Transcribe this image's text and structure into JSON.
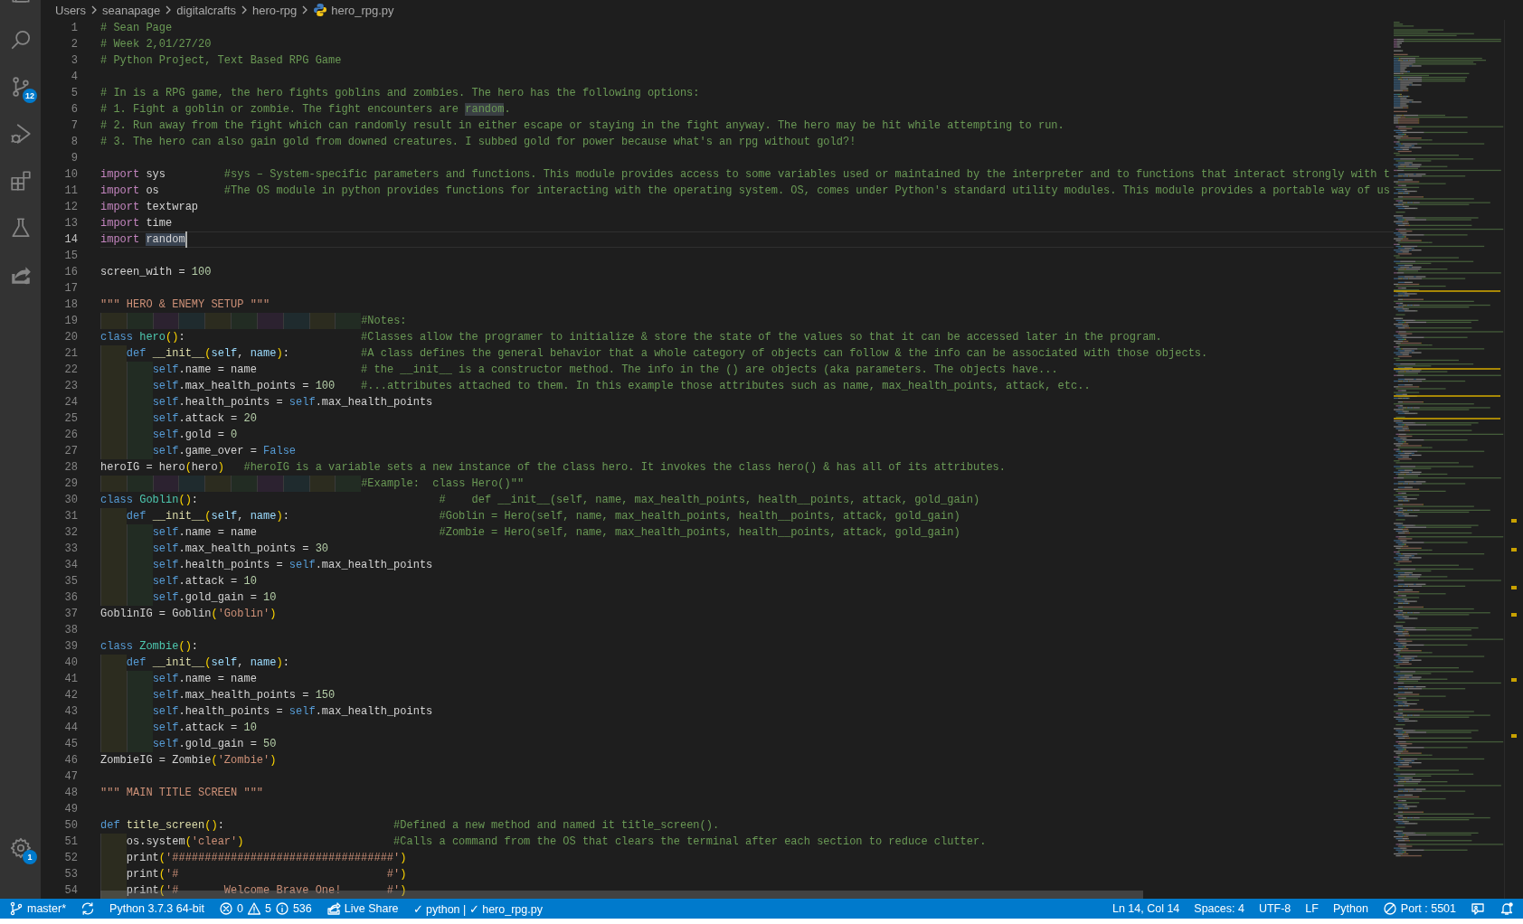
{
  "activity_bar": {
    "items": [
      {
        "kind": "files"
      },
      {
        "kind": "search"
      },
      {
        "kind": "source_control",
        "badge": "12"
      },
      {
        "kind": "run"
      },
      {
        "kind": "extensions"
      },
      {
        "kind": "testing"
      },
      {
        "kind": "share"
      }
    ],
    "bottom": [
      {
        "kind": "settings",
        "badge": "1"
      }
    ]
  },
  "breadcrumb": [
    {
      "label": "Users"
    },
    {
      "label": "seanapage"
    },
    {
      "label": "digitalcrafts"
    },
    {
      "label": "hero-rpg"
    },
    {
      "label": "hero_rpg.py",
      "kind": "python_file"
    }
  ],
  "editor": {
    "lines": [
      {
        "number": "1",
        "current": false,
        "tokens": [
          {
            "kind": "comment",
            "text": "# Sean Page"
          }
        ]
      },
      {
        "number": "2",
        "current": false,
        "tokens": [
          {
            "kind": "comment",
            "text": "# Week 2,01/27/20"
          }
        ]
      },
      {
        "number": "3",
        "current": false,
        "tokens": [
          {
            "kind": "comment",
            "text": "# Python Project, Text Based RPG Game"
          }
        ]
      },
      {
        "number": "4",
        "current": false
      },
      {
        "number": "5",
        "current": false,
        "tokens": [
          {
            "kind": "comment",
            "text": "# In is a RPG game, the hero fights goblins and zombies. The hero has the following options:"
          }
        ]
      },
      {
        "number": "6",
        "current": false,
        "tokens": [
          {
            "kind": "comment",
            "text": "# 1. Fight a goblin or zombie. The fight encounters are "
          },
          {
            "kind": "match",
            "text": "random"
          },
          {
            "kind": "comment",
            "text": "."
          }
        ]
      },
      {
        "number": "7",
        "current": false,
        "tokens": [
          {
            "kind": "comment",
            "text": "# 2. Run away from the fight which can randomly result in either escape or staying in the fight anyway. The hero may be hit while attempting to run."
          }
        ]
      },
      {
        "number": "8",
        "current": false,
        "tokens": [
          {
            "kind": "comment",
            "text": "# 3. The hero can also gain gold from downed creatures. I subbed gold for power because what's an rpg without gold?!"
          }
        ]
      },
      {
        "number": "9",
        "current": false
      },
      {
        "number": "10",
        "current": false,
        "tokens": [
          {
            "kind": "import",
            "text": "import"
          },
          {
            "kind": "plain",
            "text": " sys         "
          },
          {
            "kind": "comment",
            "text": "#sys – System-specific parameters and functions. This module provides access to some variables used or maintained by the interpreter and to functions that interact strongly with t"
          }
        ]
      },
      {
        "number": "11",
        "current": false,
        "tokens": [
          {
            "kind": "import",
            "text": "import"
          },
          {
            "kind": "plain",
            "text": " os          "
          },
          {
            "kind": "comment",
            "text": "#The OS module in python provides functions for interacting with the operating system. OS, comes under Python's standard utility modules. This module provides a portable way of us"
          }
        ]
      },
      {
        "number": "12",
        "current": false,
        "tokens": [
          {
            "kind": "import",
            "text": "import"
          },
          {
            "kind": "plain",
            "text": " textwrap"
          }
        ]
      },
      {
        "number": "13",
        "current": false,
        "tokens": [
          {
            "kind": "import",
            "text": "import"
          },
          {
            "kind": "plain",
            "text": " time"
          }
        ]
      },
      {
        "number": "14",
        "current": true,
        "tokens": [
          {
            "kind": "import",
            "text": "import "
          },
          {
            "kind": "selection",
            "text": "random"
          }
        ]
      },
      {
        "number": "15",
        "current": false
      },
      {
        "number": "16",
        "current": false,
        "tokens": [
          {
            "kind": "plain",
            "text": "screen_with = "
          },
          {
            "kind": "number",
            "text": "100"
          }
        ]
      },
      {
        "number": "17",
        "current": false
      },
      {
        "number": "18",
        "current": false,
        "tokens": [
          {
            "kind": "string",
            "text": "\"\"\" HERO & ENEMY SETUP \"\"\""
          }
        ]
      },
      {
        "number": "19",
        "current": false,
        "tokens": [
          {
            "kind": "comment",
            "text": "                                        #Notes:"
          }
        ]
      },
      {
        "number": "20",
        "current": false,
        "tokens": [
          {
            "kind": "keyword",
            "text": "class "
          },
          {
            "kind": "type",
            "text": "hero"
          },
          {
            "kind": "bracket",
            "text": "()"
          },
          {
            "kind": "plain",
            "text": ":                           "
          },
          {
            "kind": "comment",
            "text": "#Classes allow the programer to initialize & store the state of the values so that it can be accessed later in the program."
          }
        ]
      },
      {
        "number": "21",
        "current": false,
        "tokens": [
          {
            "kind": "keyword",
            "text": "    def "
          },
          {
            "kind": "function",
            "text": "__init__"
          },
          {
            "kind": "bracket",
            "text": "("
          },
          {
            "kind": "param",
            "text": "self"
          },
          {
            "kind": "plain",
            "text": ", "
          },
          {
            "kind": "param",
            "text": "name"
          },
          {
            "kind": "bracket",
            "text": ")"
          },
          {
            "kind": "plain",
            "text": ":           "
          },
          {
            "kind": "comment",
            "text": "#A class defines the general behavior that a whole category of objects can follow & the info can be associated with those objects."
          }
        ]
      },
      {
        "number": "22",
        "current": false,
        "tokens": [
          {
            "kind": "keyword",
            "text": "        self"
          },
          {
            "kind": "plain",
            "text": ".name = name                "
          },
          {
            "kind": "comment",
            "text": "# the __init__ is a constructor method. The info in the () are objects (aka parameters. The objects have..."
          }
        ]
      },
      {
        "number": "23",
        "current": false,
        "tokens": [
          {
            "kind": "keyword",
            "text": "        self"
          },
          {
            "kind": "plain",
            "text": ".max_health_points = "
          },
          {
            "kind": "number",
            "text": "100"
          },
          {
            "kind": "comment",
            "text": "    #...attributes attached to them. In this example those attributes such as name, max_health_points, attack, etc.."
          }
        ]
      },
      {
        "number": "24",
        "current": false,
        "tokens": [
          {
            "kind": "keyword",
            "text": "        self"
          },
          {
            "kind": "plain",
            "text": ".health_points = "
          },
          {
            "kind": "keyword",
            "text": "self"
          },
          {
            "kind": "plain",
            "text": ".max_health_points"
          }
        ]
      },
      {
        "number": "25",
        "current": false,
        "tokens": [
          {
            "kind": "keyword",
            "text": "        self"
          },
          {
            "kind": "plain",
            "text": ".attack = "
          },
          {
            "kind": "number",
            "text": "20"
          }
        ]
      },
      {
        "number": "26",
        "current": false,
        "tokens": [
          {
            "kind": "keyword",
            "text": "        self"
          },
          {
            "kind": "plain",
            "text": ".gold = "
          },
          {
            "kind": "number",
            "text": "0"
          }
        ]
      },
      {
        "number": "27",
        "current": false,
        "tokens": [
          {
            "kind": "keyword",
            "text": "        self"
          },
          {
            "kind": "plain",
            "text": ".game_over = "
          },
          {
            "kind": "keyword",
            "text": "False"
          }
        ]
      },
      {
        "number": "28",
        "current": false,
        "tokens": [
          {
            "kind": "plain",
            "text": "heroIG = hero"
          },
          {
            "kind": "bracket",
            "text": "("
          },
          {
            "kind": "plain",
            "text": "hero"
          },
          {
            "kind": "bracket",
            "text": ")"
          },
          {
            "kind": "comment",
            "text": "   #heroIG is a variable sets a new instance of the class hero. It invokes the class hero() & has all of its attributes."
          }
        ]
      },
      {
        "number": "29",
        "current": false,
        "tokens": [
          {
            "kind": "comment",
            "text": "                                        #Example:  class Hero()\"\""
          }
        ]
      },
      {
        "number": "30",
        "current": false,
        "tokens": [
          {
            "kind": "keyword",
            "text": "class "
          },
          {
            "kind": "type",
            "text": "Goblin"
          },
          {
            "kind": "bracket",
            "text": "()"
          },
          {
            "kind": "plain",
            "text": ":                                     "
          },
          {
            "kind": "comment",
            "text": "#    def __init__(self, name, max_health_points, health__points, attack, gold_gain)"
          }
        ]
      },
      {
        "number": "31",
        "current": false,
        "tokens": [
          {
            "kind": "keyword",
            "text": "    def "
          },
          {
            "kind": "function",
            "text": "__init__"
          },
          {
            "kind": "bracket",
            "text": "("
          },
          {
            "kind": "param",
            "text": "self"
          },
          {
            "kind": "plain",
            "text": ", "
          },
          {
            "kind": "param",
            "text": "name"
          },
          {
            "kind": "bracket",
            "text": ")"
          },
          {
            "kind": "plain",
            "text": ":                       "
          },
          {
            "kind": "comment",
            "text": "#Goblin = Hero(self, name, max_health_points, health__points, attack, gold_gain)"
          }
        ]
      },
      {
        "number": "32",
        "current": false,
        "tokens": [
          {
            "kind": "keyword",
            "text": "        self"
          },
          {
            "kind": "plain",
            "text": ".name = name                            "
          },
          {
            "kind": "comment",
            "text": "#Zombie = Hero(self, name, max_health_points, health__points, attack, gold_gain)"
          }
        ]
      },
      {
        "number": "33",
        "current": false,
        "tokens": [
          {
            "kind": "keyword",
            "text": "        self"
          },
          {
            "kind": "plain",
            "text": ".max_health_points = "
          },
          {
            "kind": "number",
            "text": "30"
          }
        ]
      },
      {
        "number": "34",
        "current": false,
        "tokens": [
          {
            "kind": "keyword",
            "text": "        self"
          },
          {
            "kind": "plain",
            "text": ".health_points = "
          },
          {
            "kind": "keyword",
            "text": "self"
          },
          {
            "kind": "plain",
            "text": ".max_health_points"
          }
        ]
      },
      {
        "number": "35",
        "current": false,
        "tokens": [
          {
            "kind": "keyword",
            "text": "        self"
          },
          {
            "kind": "plain",
            "text": ".attack = "
          },
          {
            "kind": "number",
            "text": "10"
          }
        ]
      },
      {
        "number": "36",
        "current": false,
        "tokens": [
          {
            "kind": "keyword",
            "text": "        self"
          },
          {
            "kind": "plain",
            "text": ".gold_gain = "
          },
          {
            "kind": "number",
            "text": "10"
          }
        ]
      },
      {
        "number": "37",
        "current": false,
        "tokens": [
          {
            "kind": "plain",
            "text": "GoblinIG = Goblin"
          },
          {
            "kind": "bracket",
            "text": "("
          },
          {
            "kind": "string",
            "text": "'Goblin'"
          },
          {
            "kind": "bracket",
            "text": ")"
          }
        ]
      },
      {
        "number": "38",
        "current": false
      },
      {
        "number": "39",
        "current": false,
        "tokens": [
          {
            "kind": "keyword",
            "text": "class "
          },
          {
            "kind": "type",
            "text": "Zombie"
          },
          {
            "kind": "bracket",
            "text": "()"
          },
          {
            "kind": "plain",
            "text": ":"
          }
        ]
      },
      {
        "number": "40",
        "current": false,
        "tokens": [
          {
            "kind": "keyword",
            "text": "    def "
          },
          {
            "kind": "function",
            "text": "__init__"
          },
          {
            "kind": "bracket",
            "text": "("
          },
          {
            "kind": "param",
            "text": "self"
          },
          {
            "kind": "plain",
            "text": ", "
          },
          {
            "kind": "param",
            "text": "name"
          },
          {
            "kind": "bracket",
            "text": ")"
          },
          {
            "kind": "plain",
            "text": ":"
          }
        ]
      },
      {
        "number": "41",
        "current": false,
        "tokens": [
          {
            "kind": "keyword",
            "text": "        self"
          },
          {
            "kind": "plain",
            "text": ".name = name"
          }
        ]
      },
      {
        "number": "42",
        "current": false,
        "tokens": [
          {
            "kind": "keyword",
            "text": "        self"
          },
          {
            "kind": "plain",
            "text": ".max_health_points = "
          },
          {
            "kind": "number",
            "text": "150"
          }
        ]
      },
      {
        "number": "43",
        "current": false,
        "tokens": [
          {
            "kind": "keyword",
            "text": "        self"
          },
          {
            "kind": "plain",
            "text": ".health_points = "
          },
          {
            "kind": "keyword",
            "text": "self"
          },
          {
            "kind": "plain",
            "text": ".max_health_points"
          }
        ]
      },
      {
        "number": "44",
        "current": false,
        "tokens": [
          {
            "kind": "keyword",
            "text": "        self"
          },
          {
            "kind": "plain",
            "text": ".attack = "
          },
          {
            "kind": "number",
            "text": "10"
          }
        ]
      },
      {
        "number": "45",
        "current": false,
        "tokens": [
          {
            "kind": "keyword",
            "text": "        self"
          },
          {
            "kind": "plain",
            "text": ".gold_gain = "
          },
          {
            "kind": "number",
            "text": "50"
          }
        ]
      },
      {
        "number": "46",
        "current": false,
        "tokens": [
          {
            "kind": "plain",
            "text": "ZombieIG = Zombie"
          },
          {
            "kind": "bracket",
            "text": "("
          },
          {
            "kind": "string",
            "text": "'Zombie'"
          },
          {
            "kind": "bracket",
            "text": ")"
          }
        ]
      },
      {
        "number": "47",
        "current": false
      },
      {
        "number": "48",
        "current": false,
        "tokens": [
          {
            "kind": "string",
            "text": "\"\"\" MAIN TITLE SCREEN \"\"\""
          }
        ]
      },
      {
        "number": "49",
        "current": false
      },
      {
        "number": "50",
        "current": false,
        "tokens": [
          {
            "kind": "keyword",
            "text": "def "
          },
          {
            "kind": "function",
            "text": "title_screen"
          },
          {
            "kind": "bracket",
            "text": "()"
          },
          {
            "kind": "plain",
            "text": ":                          "
          },
          {
            "kind": "comment",
            "text": "#Defined a new method and named it title_screen()."
          }
        ]
      },
      {
        "number": "51",
        "current": false,
        "tokens": [
          {
            "kind": "plain",
            "text": "    os.system"
          },
          {
            "kind": "bracket",
            "text": "("
          },
          {
            "kind": "string",
            "text": "'clear'"
          },
          {
            "kind": "bracket",
            "text": ")"
          },
          {
            "kind": "comment",
            "text": "                       #Calls a command from the OS that clears the terminal after each section to reduce clutter."
          }
        ]
      },
      {
        "number": "52",
        "current": false,
        "tokens": [
          {
            "kind": "plain",
            "text": "    print"
          },
          {
            "kind": "bracket",
            "text": "("
          },
          {
            "kind": "string",
            "text": "'##################################'"
          },
          {
            "kind": "bracket",
            "text": ")"
          }
        ]
      },
      {
        "number": "53",
        "current": false,
        "tokens": [
          {
            "kind": "plain",
            "text": "    print"
          },
          {
            "kind": "bracket",
            "text": "("
          },
          {
            "kind": "string",
            "text": "'#                                #'"
          },
          {
            "kind": "bracket",
            "text": ")"
          }
        ]
      },
      {
        "number": "54",
        "current": false,
        "tokens": [
          {
            "kind": "plain",
            "text": "    print"
          },
          {
            "kind": "bracket",
            "text": "("
          },
          {
            "kind": "string",
            "text": "'#       Welcome Brave One!       #'"
          },
          {
            "kind": "bracket",
            "text": ")"
          }
        ]
      }
    ]
  },
  "status_bar": {
    "left": [
      {
        "kind": "branch",
        "text": "master*"
      },
      {
        "kind": "sync"
      },
      {
        "kind": "plain",
        "text": "Python 3.7.3 64-bit"
      },
      {
        "kind": "problems",
        "errors": "0",
        "warnings": "5",
        "infos": "536"
      },
      {
        "kind": "live_share",
        "text": "Live Share"
      },
      {
        "kind": "plain",
        "text": "✓ python | ✓ hero_rpg.py"
      }
    ],
    "right": [
      {
        "kind": "plain",
        "text": "Ln 14, Col 14"
      },
      {
        "kind": "plain",
        "text": "Spaces: 4"
      },
      {
        "kind": "plain",
        "text": "UTF-8"
      },
      {
        "kind": "plain",
        "text": "LF"
      },
      {
        "kind": "plain",
        "text": "Python"
      },
      {
        "kind": "port",
        "text": "Port : 5501"
      },
      {
        "kind": "feedback"
      },
      {
        "kind": "bell"
      }
    ]
  }
}
